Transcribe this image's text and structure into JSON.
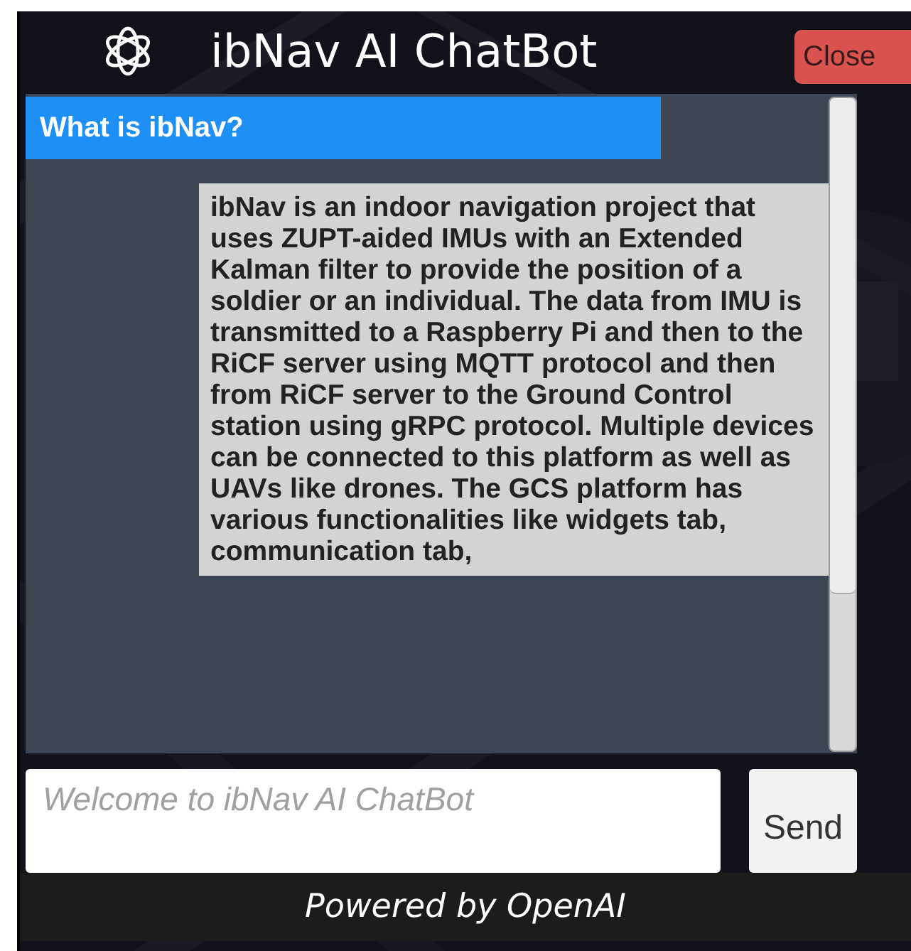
{
  "header": {
    "title": "ibNav AI ChatBot",
    "close_button": "Close"
  },
  "chat": {
    "messages": [
      {
        "kind": "question",
        "text": "What is ibNav?"
      },
      {
        "kind": "answer",
        "text": "ibNav is an indoor navigation project that uses ZUPT-aided IMUs with an Extended Kalman filter to provide the position of a soldier or an individual. The data from IMU is transmitted to a Raspberry Pi and then to the RiCF server using MQTT protocol and then from RiCF server to the Ground Control station using gRPC protocol. Multiple devices can be connected to this platform as well as UAVs like drones. The GCS platform has various functionalities like widgets tab, communication tab,"
      }
    ]
  },
  "input": {
    "placeholder": "Welcome to ibNav AI ChatBot",
    "send_button": "Send"
  },
  "footer": "Powered by OpenAI"
}
